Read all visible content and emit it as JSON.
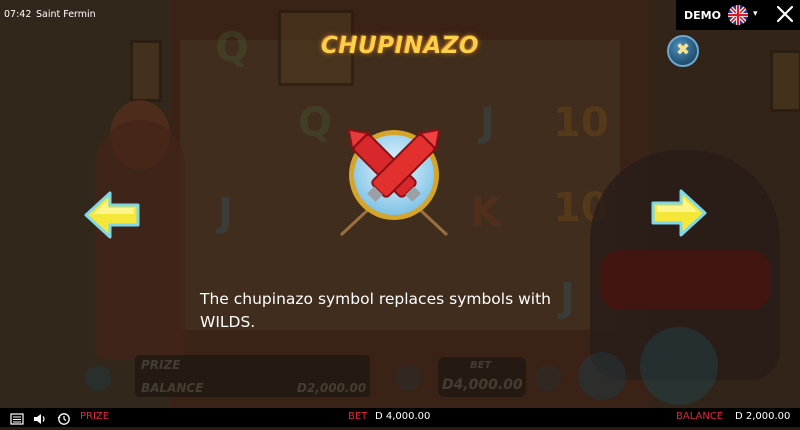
{
  "topbar": {
    "time": "07:42",
    "game_title": "Saint Fermin",
    "mode": "DEMO",
    "language_icon": "uk-flag-icon",
    "dropdown_caret": "▾",
    "close_icon": "close-icon"
  },
  "popup": {
    "title": "CHUPINAZO",
    "description": "The chupinazo symbol replaces symbols with WILDS.",
    "close_symbol": "✖",
    "prev_icon": "arrow-left-icon",
    "next_icon": "arrow-right-icon",
    "symbol_icon": "chupinazo-symbol-icon"
  },
  "background": {
    "prize_label": "PRIZE",
    "balance_label": "BALANCE",
    "balance_value": "D2,000.00",
    "bet_label": "BET",
    "bet_value": "D4,000.00",
    "reel_symbols": [
      "Q",
      "10",
      "J",
      "Q",
      "J",
      "10",
      "J",
      "K",
      "J"
    ]
  },
  "bottombar": {
    "prize_label": "PRIZE",
    "bet_label": "BET",
    "bet_value": "D 4,000.00",
    "balance_label": "BALANCE",
    "balance_value": "D 2,000.00",
    "icons": [
      "menu-icon",
      "sound-icon",
      "history-icon"
    ]
  },
  "colors": {
    "title_gold": "#f7d24a",
    "accent_red": "#e0283c",
    "arrow_yellow": "#f5e63a",
    "arrow_cyan": "#7fd8e8",
    "close_blue": "#2f6f9a"
  }
}
